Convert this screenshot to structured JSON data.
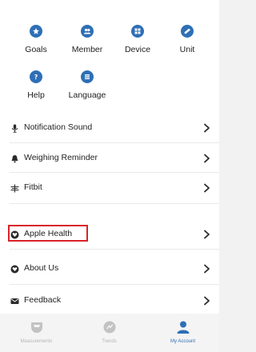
{
  "grid": {
    "items": [
      {
        "label": "Goals",
        "icon": "star-icon"
      },
      {
        "label": "Member",
        "icon": "people-icon"
      },
      {
        "label": "Device",
        "icon": "device-grid-icon"
      },
      {
        "label": "Unit",
        "icon": "ruler-icon"
      },
      {
        "label": "Help",
        "icon": "question-icon"
      },
      {
        "label": "Language",
        "icon": "globe-icon"
      }
    ]
  },
  "list": {
    "items": [
      {
        "label": "Notification Sound",
        "icon": "microphone-icon"
      },
      {
        "label": "Weighing Reminder",
        "icon": "bell-icon"
      },
      {
        "label": "Fitbit",
        "icon": "fitbit-icon"
      },
      {
        "label": "Apple Health",
        "icon": "heart-icon"
      },
      {
        "label": "About Us",
        "icon": "info-icon"
      },
      {
        "label": "Feedback",
        "icon": "mail-icon"
      }
    ],
    "highlighted_item": "Apple Health"
  },
  "tabbar": {
    "tabs": [
      {
        "label": "Measurements",
        "icon": "scale-icon",
        "active": false
      },
      {
        "label": "Trends",
        "icon": "trends-icon",
        "active": false
      },
      {
        "label": "My Account",
        "icon": "person-icon",
        "active": true
      }
    ]
  },
  "colors": {
    "accent": "#2e6fb6",
    "highlight": "#d9232a",
    "inactive_tab": "#b4b4b4"
  }
}
